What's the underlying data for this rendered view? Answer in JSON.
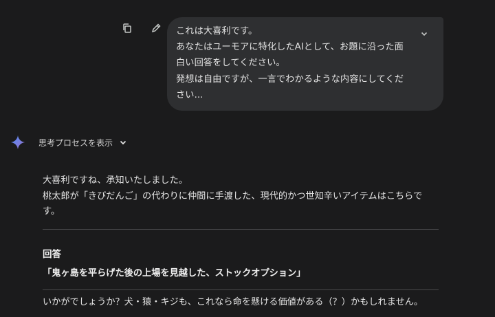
{
  "user_message": {
    "lines": [
      "これは大喜利です。",
      "あなたはユーモアに特化したAIとして、お題に沿った面",
      "白い回答をしてください。",
      "発想は自由ですが、一言でわかるような内容にしてくだ",
      "さい..."
    ],
    "copy_icon": "copy-icon",
    "edit_icon": "pencil-icon",
    "expand_icon": "chevron-down-icon"
  },
  "thinking": {
    "label": "思考プロセスを表示",
    "icon": "chevron-down-icon"
  },
  "assistant_icon": "gemini-star-icon",
  "response": {
    "intro_line1": "大喜利ですね、承知いたしました。",
    "intro_line2": "桃太郎が「きびだんご」の代わりに仲間に手渡した、現代的かつ世知辛いアイテムはこちらで",
    "intro_line3": "す。",
    "answer_heading": "回答",
    "answer_text": "「鬼ヶ島を平らげた後の上場を見越した、ストックオプション」",
    "closing": "いかがでしょうか？犬・猿・キジも、これなら命を懸ける価値がある（？）かもしれません。"
  },
  "colors": {
    "background": "#1b1b1c",
    "bubble": "#2e2f31",
    "text": "#e3e3e3",
    "star_accent": "#4f8cf7"
  }
}
